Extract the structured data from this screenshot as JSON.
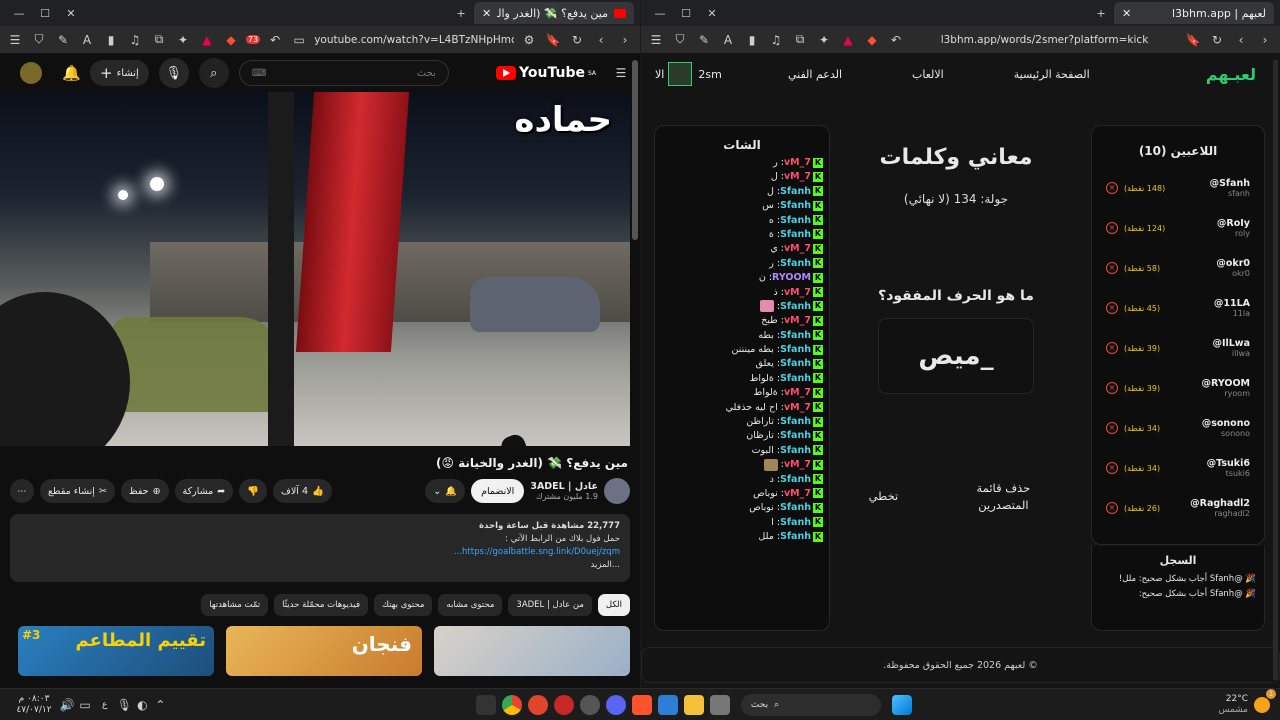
{
  "left_browser": {
    "tab_title": "مين يدفع؟ 💸 (الغدر والخيانة 😡",
    "url": "youtube.com/watch?v=L4BTzNHpHmc",
    "ext_badge": "73"
  },
  "youtube": {
    "logo": "YouTube",
    "logo_region": "SA",
    "search_placeholder": "بحث",
    "create_label": "إنشاء",
    "video_overlay_text": "حماده",
    "video_title": "مين يدفع؟ 💸 (الغدر والخيانة 😡)",
    "channel_name": "عادل | 3ADEL",
    "subscribers": "1.9 مليون مشترك",
    "join_label": "الانضمام",
    "likes": "4 آلاف",
    "share_label": "مشاركة",
    "save_label": "حفظ",
    "clip_label": "إنشاء مقطع",
    "desc_line1": "22,777 مشاهدة  قبل ساعة واحدة",
    "desc_line2": "حمل فول بلاك من الرابط الآتي :",
    "desc_link": "https://goalbattle.sng.link/D0uej/zqm...",
    "desc_more": "...المزيد",
    "chips": [
      "الكل",
      "من عادل | 3ADEL",
      "محتوى مشابه",
      "محتوى بهتك",
      "فيديوهات محمّلة حديثًا",
      "تمّت مشاهدتها"
    ],
    "thumb1_text": "تقييم المطاعم",
    "thumb1_num": "#3",
    "thumb2_text": "فنجان"
  },
  "right_browser": {
    "tab_title": "لعبهم | l3bhm.app",
    "url": "l3bhm.app/words/2smer?platform=kick"
  },
  "site": {
    "brand": "لعبـهم",
    "nav": [
      "الصفحة الرئيسية",
      "الالعاب",
      "الدعم الفني"
    ],
    "user_partial": "2sm",
    "user_partial2": "الا",
    "players_title": "اللاعبين (10)",
    "players": [
      {
        "name": "@Sfanh",
        "sub": "sfanh",
        "score": "(148 نقطة)"
      },
      {
        "name": "@RoIy",
        "sub": "roly",
        "score": "(124 نقطة)"
      },
      {
        "name": "@okr0",
        "sub": "okr0",
        "score": "(58 نقطة)"
      },
      {
        "name": "@11LA",
        "sub": "11la",
        "score": "(45 نقطة)"
      },
      {
        "name": "@IlLwa",
        "sub": "illwa",
        "score": "(39 نقطة)"
      },
      {
        "name": "@RYOOM",
        "sub": "ryoom",
        "score": "(39 نقطة)"
      },
      {
        "name": "@sonono",
        "sub": "sonono",
        "score": "(34 نقطة)"
      },
      {
        "name": "@Tsuki6",
        "sub": "tsuki6",
        "score": "(34 نقطة)"
      },
      {
        "name": "@Raghadl2",
        "sub": "raghadl2",
        "score": "(26 نقطة)"
      }
    ],
    "log_title": "السجل",
    "log": [
      "🎉 @Sfanh أجاب بشكل صحيح: ملل!",
      "🎉 @Sfanh أجاب بشكل صحيح:"
    ],
    "game_title": "معاني وكلمات",
    "round": "جولة: 134 (لا نهائي)",
    "question": "ما هو الحرف المفقود؟",
    "word": "_ميص",
    "reset_label": "حذف قائمة المتصدرين",
    "skip_label": "تخطي",
    "chat_title": "الشات",
    "chat": [
      {
        "user": "vM_7",
        "color": "red",
        "msg": "ر"
      },
      {
        "user": "vM_7",
        "color": "red",
        "msg": "ل"
      },
      {
        "user": "Sfanh",
        "color": "teal",
        "msg": "ل"
      },
      {
        "user": "Sfanh",
        "color": "teal",
        "msg": "س"
      },
      {
        "user": "Sfanh",
        "color": "teal",
        "msg": "ه"
      },
      {
        "user": "Sfanh",
        "color": "teal",
        "msg": "ة"
      },
      {
        "user": "vM_7",
        "color": "red",
        "msg": "ي"
      },
      {
        "user": "Sfanh",
        "color": "teal",
        "msg": "ر"
      },
      {
        "user": "RYOOM",
        "color": "pur",
        "msg": "ن"
      },
      {
        "user": "vM_7",
        "color": "red",
        "msg": "ذ"
      },
      {
        "user": "Sfanh",
        "color": "teal",
        "msg": "",
        "emoji": "#e88ab0"
      },
      {
        "user": "vM_7",
        "color": "red",
        "msg": "طبخ"
      },
      {
        "user": "Sfanh",
        "color": "teal",
        "msg": "بطه"
      },
      {
        "user": "Sfanh",
        "color": "teal",
        "msg": "بطه مينننن"
      },
      {
        "user": "Sfanh",
        "color": "teal",
        "msg": "يعلق"
      },
      {
        "user": "Sfanh",
        "color": "teal",
        "msg": "ةلواط"
      },
      {
        "user": "vM_7",
        "color": "red",
        "msg": "ةلواط"
      },
      {
        "user": "vM_7",
        "color": "red",
        "msg": "اح ليه حذفلي"
      },
      {
        "user": "Sfanh",
        "color": "teal",
        "msg": "تاراظن"
      },
      {
        "user": "Sfanh",
        "color": "teal",
        "msg": "تارظان"
      },
      {
        "user": "Sfanh",
        "color": "teal",
        "msg": "البوت"
      },
      {
        "user": "vM_7",
        "color": "red",
        "msg": "",
        "emoji": "#a0855a"
      },
      {
        "user": "Sfanh",
        "color": "teal",
        "msg": "د"
      },
      {
        "user": "vM_7",
        "color": "red",
        "msg": "نوباص"
      },
      {
        "user": "Sfanh",
        "color": "teal",
        "msg": "نوباص"
      },
      {
        "user": "Sfanh",
        "color": "teal",
        "msg": "ا"
      },
      {
        "user": "Sfanh",
        "color": "teal",
        "msg": "ملل"
      }
    ],
    "footer": "© لعبهم 2026 جميع الحقوق محفوظة."
  },
  "taskbar": {
    "weather_temp": "22°C",
    "weather_desc": "مشمس",
    "search_placeholder": "بحث",
    "time": "٠٨:٠٣ م",
    "date": "٤٧/٠٧/١٢",
    "lang": "ع",
    "notif_count": "1"
  },
  "colors": {
    "accent_green": "#2ecc71",
    "kick_green": "#53fc18",
    "yt_red": "#ff0000"
  }
}
